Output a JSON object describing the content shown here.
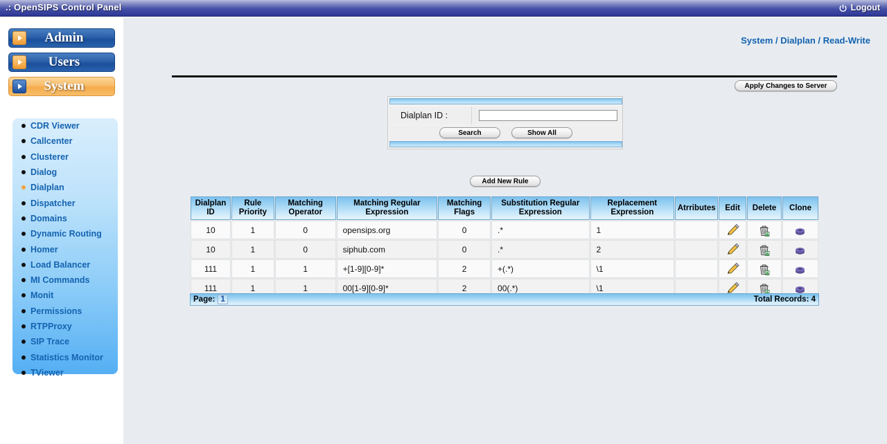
{
  "topbar": {
    "title": ".: OpenSIPS Control Panel",
    "logout_label": "Logout",
    "logout_icon": "power-icon"
  },
  "sidebar": {
    "groups": [
      {
        "label": "Admin",
        "style": "blue",
        "arrow_icon": "triangle-right-icon"
      },
      {
        "label": "Users",
        "style": "blue",
        "arrow_icon": "triangle-right-icon"
      },
      {
        "label": "System",
        "style": "orange",
        "arrow_icon": "triangle-right-icon"
      }
    ],
    "items": [
      {
        "label": "CDR Viewer",
        "active": false
      },
      {
        "label": "Callcenter",
        "active": false
      },
      {
        "label": "Clusterer",
        "active": false
      },
      {
        "label": "Dialog",
        "active": false
      },
      {
        "label": "Dialplan",
        "active": true
      },
      {
        "label": "Dispatcher",
        "active": false
      },
      {
        "label": "Domains",
        "active": false
      },
      {
        "label": "Dynamic Routing",
        "active": false
      },
      {
        "label": "Homer",
        "active": false
      },
      {
        "label": "Load Balancer",
        "active": false
      },
      {
        "label": "MI Commands",
        "active": false
      },
      {
        "label": "Monit",
        "active": false
      },
      {
        "label": "Permissions",
        "active": false
      },
      {
        "label": "RTPProxy",
        "active": false
      },
      {
        "label": "SIP Trace",
        "active": false
      },
      {
        "label": "Statistics Monitor",
        "active": false
      },
      {
        "label": "TViewer",
        "active": false
      }
    ]
  },
  "main": {
    "breadcrumb": "System / Dialplan / Read-Write",
    "apply_button": "Apply Changes to Server",
    "add_rule_button": "Add New Rule"
  },
  "search": {
    "label": "Dialplan ID :",
    "value": "",
    "placeholder": "",
    "search_button": "Search",
    "showall_button": "Show All"
  },
  "table": {
    "columns": [
      "Dialplan\nID",
      "Rule\nPriority",
      "Matching\nOperator",
      "Matching Regular\nExpression",
      "Matching\nFlags",
      "Substitution Regular\nExpression",
      "Replacement\nExpression",
      "Atrributes",
      "Edit",
      "Delete",
      "Clone"
    ],
    "rows": [
      {
        "dialplan_id": "10",
        "rule_priority": "1",
        "matching_operator": "0",
        "matching_regex": "opensips.org",
        "matching_flags": "0",
        "substitution_regex": ".*",
        "replacement_expression": "1",
        "attributes": "",
        "edit_icon": "pencil-icon",
        "delete_icon": "trash-icon",
        "clone_icon": "clone-discs-icon"
      },
      {
        "dialplan_id": "10",
        "rule_priority": "1",
        "matching_operator": "0",
        "matching_regex": "siphub.com",
        "matching_flags": "0",
        "substitution_regex": ".*",
        "replacement_expression": "2",
        "attributes": "",
        "edit_icon": "pencil-icon",
        "delete_icon": "trash-icon",
        "clone_icon": "clone-discs-icon"
      },
      {
        "dialplan_id": "111",
        "rule_priority": "1",
        "matching_operator": "1",
        "matching_regex": "+[1-9][0-9]*",
        "matching_flags": "2",
        "substitution_regex": "+(.*)",
        "replacement_expression": "\\1",
        "attributes": "",
        "edit_icon": "pencil-icon",
        "delete_icon": "trash-icon",
        "clone_icon": "clone-discs-icon"
      },
      {
        "dialplan_id": "111",
        "rule_priority": "1",
        "matching_operator": "1",
        "matching_regex": "00[1-9][0-9]*",
        "matching_flags": "2",
        "substitution_regex": "00(.*)",
        "replacement_expression": "\\1",
        "attributes": "",
        "edit_icon": "pencil-icon",
        "delete_icon": "trash-icon",
        "clone_icon": "clone-discs-icon"
      }
    ],
    "footer": {
      "page_label": "Page:",
      "page_number": "1",
      "total_records": "Total Records: 4"
    }
  },
  "colors": {
    "topbar_dark": "#2d3794",
    "accent_blue": "#1463b0",
    "active_orange": "#f0a33c",
    "content_bg": "#e8ecf0"
  }
}
